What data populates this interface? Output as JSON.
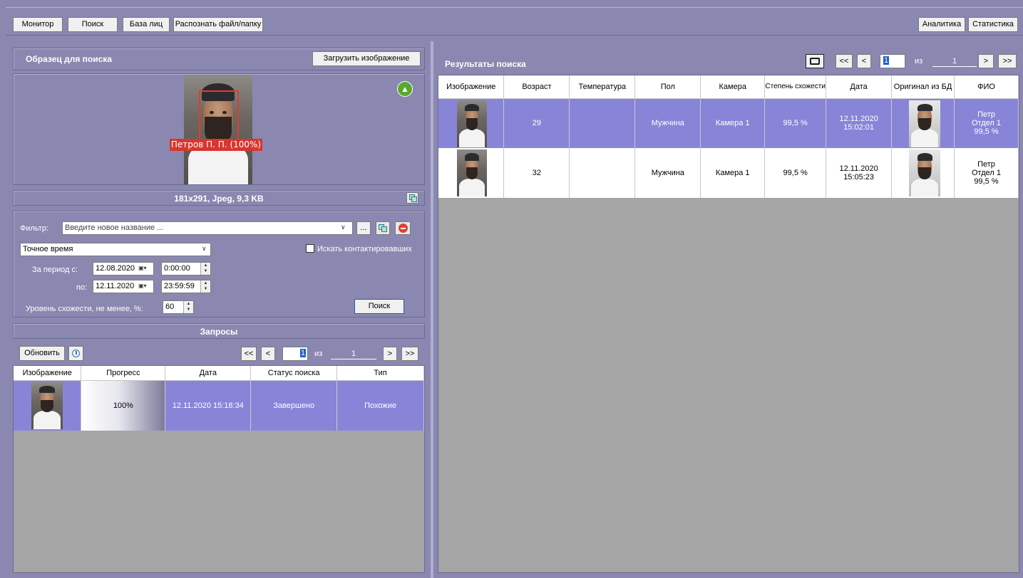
{
  "top_nav": {
    "left_buttons": [
      "Монитор",
      "Поиск",
      "База лиц",
      "Распознать файл/папку"
    ],
    "analytics": "Аналитика",
    "statistics": "Статистика"
  },
  "sample": {
    "title": "Образец для поиска",
    "upload_button": "Загрузить изображение",
    "face_label": "Петров П. П. (100%)",
    "image_info": "181x291, Jpeg, 9,3 KB"
  },
  "filter": {
    "label": "Фильтр:",
    "placeholder": "Введите новое название ...",
    "more_button": "...",
    "time_mode": "Точное время",
    "contacts_checkbox": "Искать контактировавших",
    "period_from_label": "За период с:",
    "date_from": "12.08.2020",
    "time_from": "0:00:00",
    "period_to_label": "по:",
    "date_to": "12.11.2020",
    "time_to": "23:59:59",
    "similarity_label": "Уровень схожести, не менее, %:",
    "similarity_value": "60",
    "search_button": "Поиск"
  },
  "requests": {
    "title": "Запросы",
    "refresh_button": "Обновить",
    "pager": {
      "first": "<<",
      "prev": "<",
      "current": "1",
      "of": "из",
      "total": "1",
      "next": ">",
      "last": ">>"
    },
    "columns": [
      "Изображение",
      "Прогресс",
      "Дата",
      "Статус поиска",
      "Тип"
    ],
    "rows": [
      {
        "progress": "100%",
        "progress_fraction": 1.0,
        "date": "12.11.2020 15:18:34",
        "status": "Завершено",
        "type": "Похожие"
      }
    ]
  },
  "results": {
    "title": "Результаты поиска",
    "pager": {
      "first": "<<",
      "prev": "<",
      "current": "1",
      "of": "из",
      "total": "1",
      "next": ">",
      "last": ">>"
    },
    "columns": [
      "Изображение",
      "Возраст",
      "Температура",
      "Пол",
      "Камера",
      "Степень схожести",
      "Дата",
      "Оригинал из БД",
      "ФИО"
    ],
    "rows": [
      {
        "age": "29",
        "temperature": "",
        "gender": "Мужчина",
        "camera": "Камера 1",
        "similarity": "99,5 %",
        "date": "12.11.2020",
        "time": "15:02:01",
        "fio_name": "Петр",
        "fio_dept": "Отдел 1",
        "fio_score": "99,5 %",
        "selected": true
      },
      {
        "age": "32",
        "temperature": "",
        "gender": "Мужчина",
        "camera": "Камера 1",
        "similarity": "99,5 %",
        "date": "12.11.2020",
        "time": "15:05:23",
        "fio_name": "Петр",
        "fio_dept": "Отдел 1",
        "fio_score": "99,5 %",
        "selected": false
      }
    ]
  },
  "colors": {
    "background": "#8a88b0",
    "selection": "#8885d8",
    "grid_empty": "#a5a5a5",
    "accent_red": "#d8362e",
    "accent_green": "#5aa832"
  }
}
